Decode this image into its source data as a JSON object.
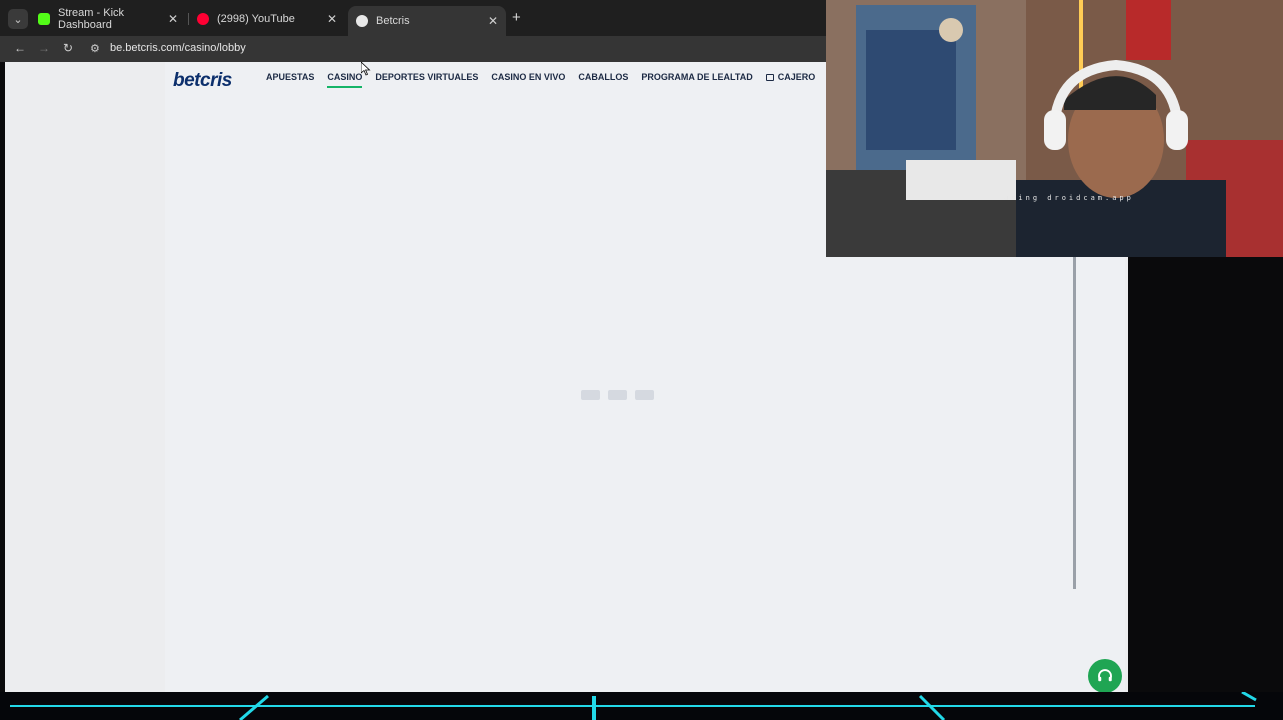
{
  "browser": {
    "tabs": [
      {
        "title": "Stream - Kick Dashboard",
        "favicon_color": "#53fc18",
        "favicon_glyph": "K"
      },
      {
        "title": "(2998) YouTube",
        "favicon_color": "#ff0033",
        "favicon_glyph": "▶"
      },
      {
        "title": "Betcris",
        "favicon_color": "#e8e8e8",
        "favicon_glyph": "b",
        "active": true
      }
    ],
    "url": "be.betcris.com/casino/lobby"
  },
  "site": {
    "logo": "betcris",
    "nav": [
      {
        "label": "APUESTAS"
      },
      {
        "label": "CASINO",
        "active": true
      },
      {
        "label": "DEPORTES VIRTUALES"
      },
      {
        "label": "CASINO EN VIVO"
      },
      {
        "label": "CABALLOS"
      },
      {
        "label": "PROGRAMA DE LEALTAD"
      },
      {
        "label": "CAJERO",
        "icon": "wallet-icon"
      }
    ],
    "support_icon": "headset-icon",
    "colors": {
      "brand_blue": "#0c2f6c",
      "accent_green": "#15b467",
      "support_green": "#1fa553"
    }
  },
  "webcam": {
    "watermark": "using droidcam.app"
  }
}
